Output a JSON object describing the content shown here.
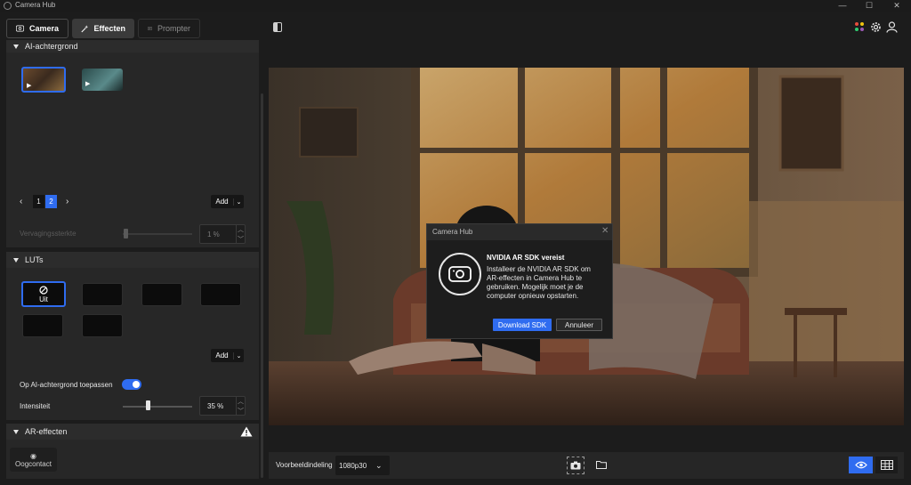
{
  "window": {
    "title": "Camera Hub",
    "minimize": "—",
    "maximize": "☐",
    "close": "✕"
  },
  "tabs": [
    {
      "label": "Camera",
      "icon": "camera-icon"
    },
    {
      "label": "Effecten",
      "icon": "magic-wand-icon"
    },
    {
      "label": "Prompter",
      "icon": "prompter-icon"
    }
  ],
  "header_icons": [
    "collapse-panel-icon",
    "apps-icon",
    "gear-icon",
    "account-icon"
  ],
  "ai_background": {
    "title": "AI-achtergrond",
    "pages": [
      "1",
      "2"
    ],
    "current_page": "2",
    "add_label": "Add",
    "blur_label": "Vervagingssterkte",
    "blur_value": "1 %",
    "blur_level": 0.01
  },
  "luts": {
    "title": "LUTs",
    "off_label": "Uit",
    "add_label": "Add",
    "apply_label": "Op AI-achtergrond toepassen",
    "apply_enabled": true,
    "intensity_label": "Intensiteit",
    "intensity_value": "35 %",
    "intensity_level": 0.35
  },
  "ar_effects": {
    "title": "AR-effecten",
    "eye_contact_label": "Oogcontact"
  },
  "bottom_bar": {
    "preview_label": "Voorbeeldindeling",
    "resolution": "1080p30"
  },
  "dialog": {
    "title": "Camera Hub",
    "heading": "NVIDIA AR SDK vereist",
    "body": "Installeer de NVIDIA AR SDK om AR-effecten in Camera Hub te gebruiken. Mogelijk moet je de computer opnieuw opstarten.",
    "primary": "Download SDK",
    "secondary": "Annuleer"
  },
  "colors": {
    "accent": "#2f6cf0",
    "background": "#1c1c1c",
    "panel": "#272727"
  }
}
